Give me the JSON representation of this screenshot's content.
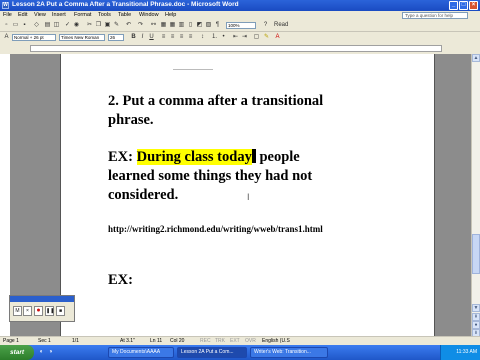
{
  "window": {
    "title": "Lesson 2A Put a Comma After a Transitional Phrase.doc - Microsoft Word"
  },
  "menu": {
    "items": [
      "File",
      "Edit",
      "View",
      "Insert",
      "Format",
      "Tools",
      "Table",
      "Window",
      "Help"
    ],
    "help_placeholder": "Type a question for help"
  },
  "toolbar": {
    "zoom": "100%",
    "read_label": "Read",
    "style": "Normal + 26 pt",
    "font": "Times New Roman",
    "size": "26"
  },
  "document": {
    "heading_line1": "2.  Put a comma after a transitional",
    "heading_line2": "phrase.",
    "ex_label": "EX: ",
    "ex_highlight": "During class today",
    "ex_rest": " people",
    "ex_line2": "learned some things they had not",
    "ex_line3": "considered.",
    "url": "http://writing2.richmond.edu/writing/wweb/trans1.html",
    "ex2_label": "EX:"
  },
  "statusbar": {
    "page": "Page 1",
    "sec": "Sec 1",
    "pages": "1/1",
    "at": "At 3.1\"",
    "ln": "Ln 11",
    "col": "Col 20",
    "flags": [
      "REC",
      "TRK",
      "EXT",
      "OVR"
    ],
    "language": "English (U.S"
  },
  "taskbar": {
    "start": "start",
    "tasks": [
      "My Documents\\AAAA",
      "Lesson 2A Put a Com...",
      "Writer's Web: Transition..."
    ],
    "clock": "11:33 AM"
  },
  "colors": {
    "highlight": "#ffff00",
    "titlebar": "#2b63d9"
  }
}
